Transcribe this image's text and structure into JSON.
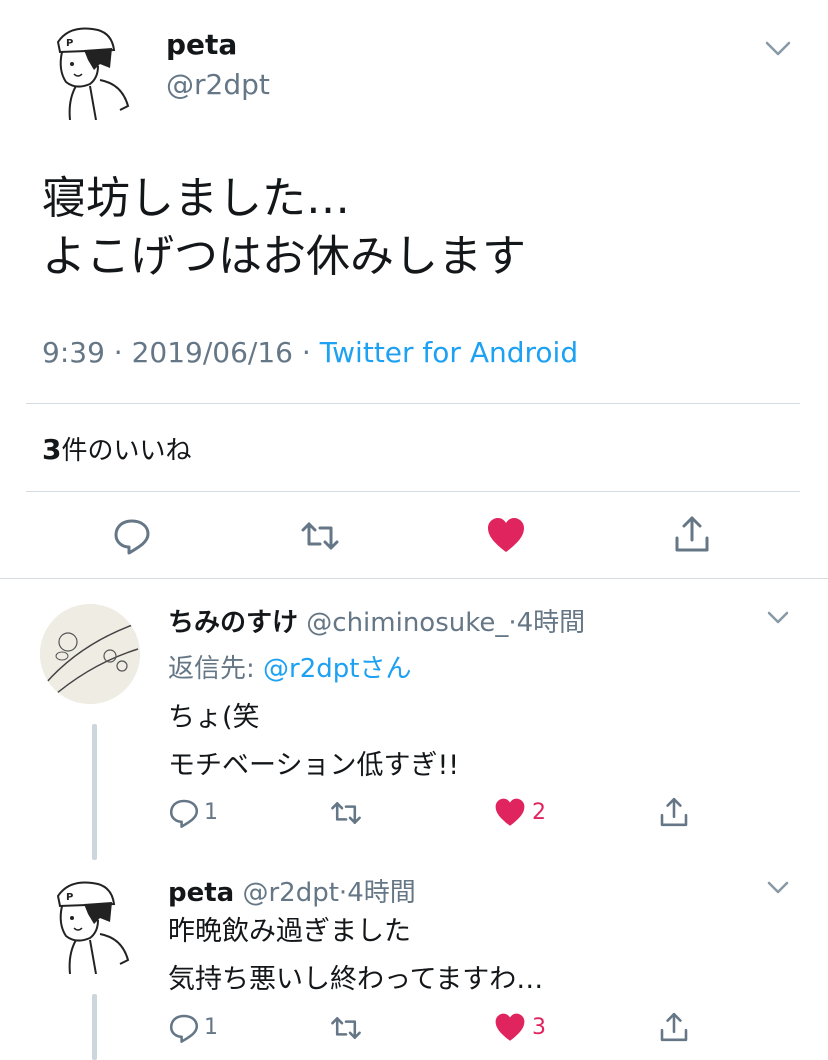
{
  "main_tweet": {
    "display_name": "peta",
    "handle": "@r2dpt",
    "text_line1": "寝坊しました…",
    "text_line2": "よこげつはお休みします",
    "time": "9:39",
    "sep1": " · ",
    "date": "2019/06/16",
    "sep2": " · ",
    "source": "Twitter for Android",
    "likes_count": "3",
    "likes_label": "件のいいね"
  },
  "replies": [
    {
      "display_name": "ちみのすけ",
      "handle": "@chiminosuke_",
      "sep": "·",
      "time": "4時間",
      "reply_to_label": "返信先: ",
      "reply_to_handle": "@r2dptさん",
      "text_line1": "ちょ(笑",
      "text_line2": "モチベーション低すぎ!!",
      "reply_count": "1",
      "like_count": "2"
    },
    {
      "display_name": "peta",
      "handle": "@r2dpt",
      "sep": "·",
      "time": "4時間",
      "text_line1": "昨晩飲み過ぎました",
      "text_line2": "気持ち悪いし終わってますわ…",
      "reply_count": "1",
      "like_count": "3"
    }
  ],
  "colors": {
    "text": "#14171a",
    "secondary": "#657786",
    "link": "#1da1f2",
    "like": "#e0245e",
    "divider": "#d6dbe0"
  },
  "icons": [
    "chevron-down-icon",
    "reply-icon",
    "retweet-icon",
    "like-icon",
    "share-icon"
  ]
}
